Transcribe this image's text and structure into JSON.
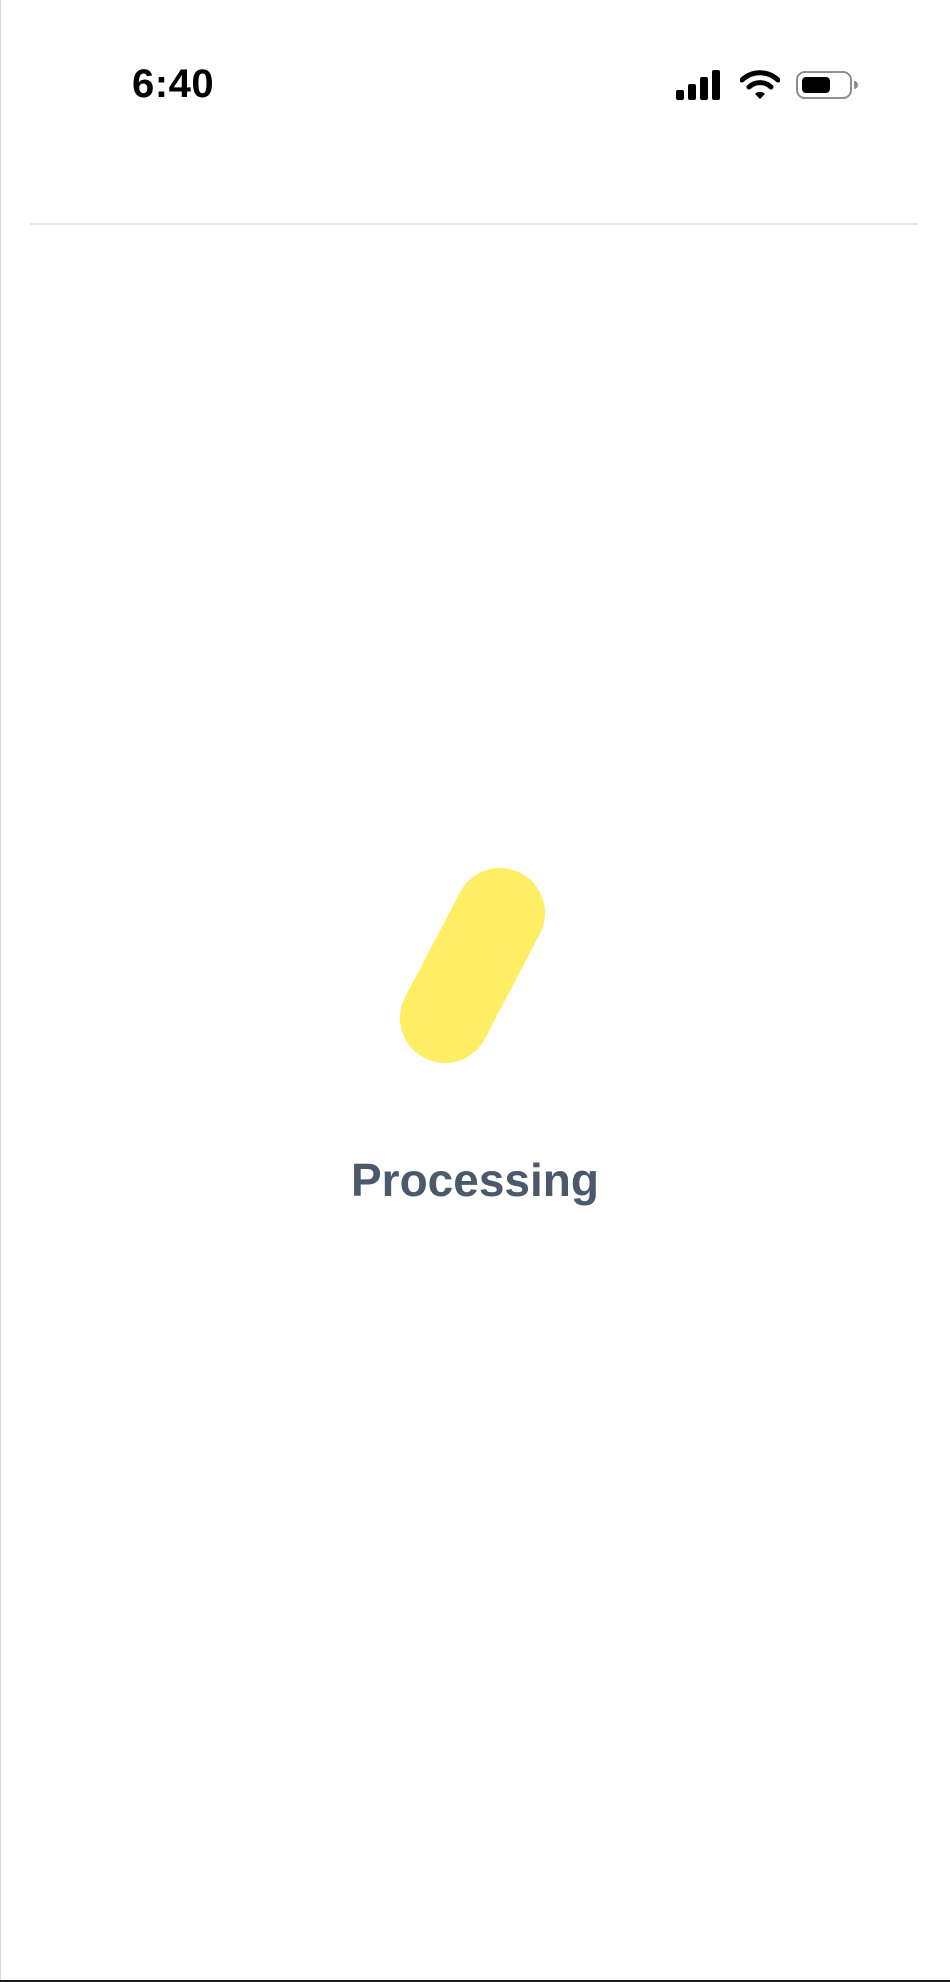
{
  "status_bar": {
    "time": "6:40",
    "icons": [
      "signal-icon",
      "wifi-icon",
      "battery-icon"
    ]
  },
  "loader": {
    "icon": "loading-spinner-icon",
    "color": "#FFED63"
  },
  "main": {
    "status_text": "Processing",
    "status_text_color": "#4A5A6B"
  }
}
